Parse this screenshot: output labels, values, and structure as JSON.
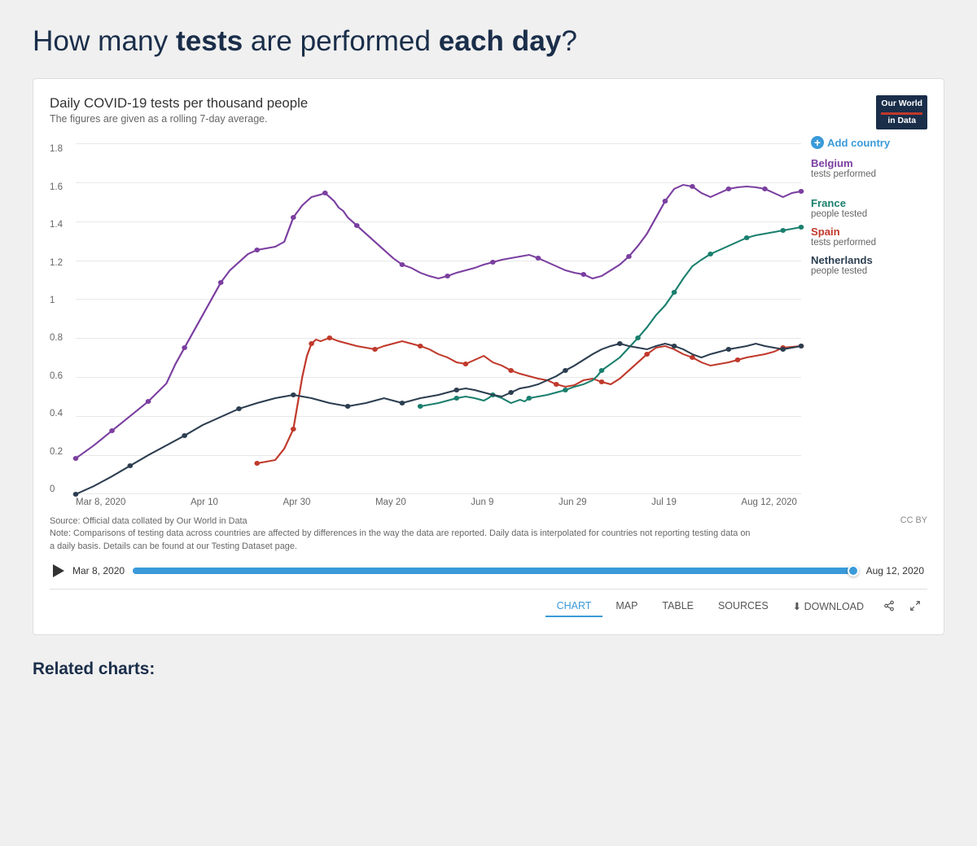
{
  "page": {
    "title_plain": "How many ",
    "title_bold1": "tests",
    "title_mid": " are performed ",
    "title_bold2": "each day",
    "title_end": "?"
  },
  "chart": {
    "title": "Daily COVID-19 tests per thousand people",
    "subtitle": "The figures are given as a rolling 7-day average.",
    "logo_line1": "Our World",
    "logo_line2": "in Data",
    "y_axis": [
      "0",
      "0.2",
      "0.4",
      "0.6",
      "0.8",
      "1",
      "1.2",
      "1.4",
      "1.6",
      "1.8"
    ],
    "x_axis": [
      "Mar 8, 2020",
      "Apr 10",
      "Apr 30",
      "May 20",
      "Jun 9",
      "Jun 29",
      "Jul 19",
      "Aug 12, 2020"
    ],
    "legend": {
      "add_label": "Add country",
      "countries": [
        {
          "name": "Belgium",
          "detail": "tests performed",
          "color": "#7b3fa0"
        },
        {
          "name": "France",
          "detail": "people tested",
          "color": "#1a7f6e"
        },
        {
          "name": "Spain",
          "detail": "tests performed",
          "color": "#c0392b"
        },
        {
          "name": "Netherlands",
          "detail": "people tested",
          "color": "#2c3e50"
        }
      ]
    },
    "source_text": "Source: Official data collated by Our World in Data\nNote: Comparisons of testing data across countries are affected by differences in the way the data are reported. Daily data is interpolated for countries not reporting testing data on a daily basis. Details can be found at our Testing Dataset page.",
    "cc": "CC BY",
    "timeline": {
      "start": "Mar 8, 2020",
      "end": "Aug 12, 2020"
    },
    "tabs": [
      "CHART",
      "MAP",
      "TABLE",
      "SOURCES",
      "DOWNLOAD"
    ],
    "active_tab": "CHART"
  },
  "related_title": "Related charts:"
}
